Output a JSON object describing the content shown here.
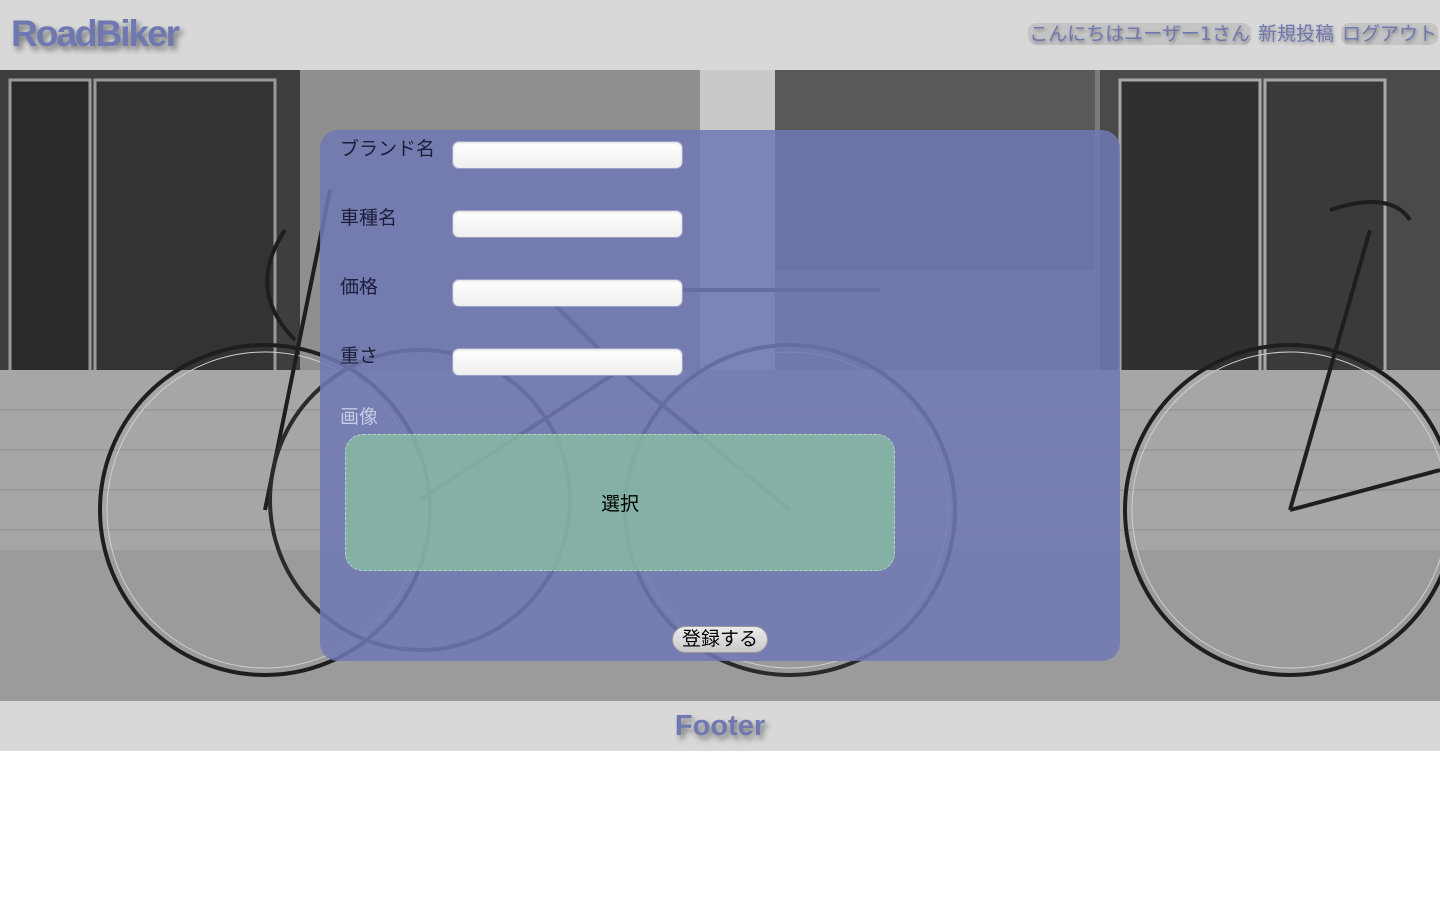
{
  "header": {
    "logo": "RoadBiker",
    "nav": {
      "greeting": "こんにちはユーザー1さん",
      "new_post": "新規投稿",
      "logout": "ログアウト"
    }
  },
  "form": {
    "brand_label": "ブランド名",
    "model_label": "車種名",
    "price_label": "価格",
    "weight_label": "重さ",
    "image_label": "画像",
    "brand_value": "",
    "model_value": "",
    "price_value": "",
    "weight_value": "",
    "select_label": "選択",
    "submit_label": "登録する"
  },
  "footer": {
    "text": "Footer"
  },
  "colors": {
    "accent": "#6f78b0",
    "card": "#7078b4",
    "dropzone": "#8cc8a0",
    "bar": "#d8d8d8"
  },
  "icons": {
    "background": "bicycle-photo"
  }
}
